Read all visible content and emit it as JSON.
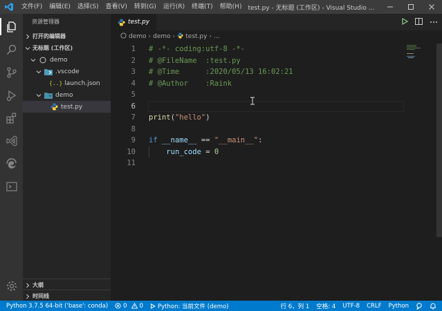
{
  "titlebar": {
    "menu": [
      "文件(F)",
      "编辑(E)",
      "选择(S)",
      "查看(V)",
      "转到(G)",
      "运行(R)",
      "终端(T)",
      "帮助(H)"
    ],
    "title": "test.py - 无标题 (工作区) - Visual Studio ..."
  },
  "activitybar": {
    "icons": [
      "files-icon",
      "search-icon",
      "source-control-icon",
      "run-debug-icon",
      "extensions-icon",
      "remote-icon",
      "edge-icon",
      "terminal-icon",
      "settings-gear-icon"
    ]
  },
  "sidebar": {
    "title": "资源管理器",
    "open_editors": "打开的编辑器",
    "workspace": "无标题 (工作区)",
    "tree": {
      "root": "demo",
      "vscode_folder": ".vscode",
      "launch_json": "launch.json",
      "demo_folder": "demo",
      "test_py": "test.py"
    },
    "outline": "大纲",
    "timeline": "时间线"
  },
  "editor": {
    "tab_label": "test.py",
    "breadcrumbs": [
      "demo",
      "demo",
      "test.py",
      "..."
    ],
    "line_numbers": [
      "1",
      "2",
      "3",
      "4",
      "5",
      "6",
      "7",
      "8",
      "9",
      "10",
      "11"
    ],
    "current_line": 6,
    "lines": [
      [
        {
          "t": "# -*- coding:utf-8 -*-",
          "c": "c"
        }
      ],
      [
        {
          "t": "# @FileName  :test.py",
          "c": "c"
        }
      ],
      [
        {
          "t": "# @Time      :2020/05/13 16:02:21",
          "c": "c"
        }
      ],
      [
        {
          "t": "# @Author    :Raink",
          "c": "c"
        }
      ],
      [],
      [],
      [
        {
          "t": "print",
          "c": "f"
        },
        {
          "t": "(",
          "c": "o"
        },
        {
          "t": "\"hello\"",
          "c": "s"
        },
        {
          "t": ")",
          "c": "o"
        }
      ],
      [],
      [
        {
          "t": "if",
          "c": "k"
        },
        {
          "t": " ",
          "c": "o"
        },
        {
          "t": "__name__",
          "c": "v"
        },
        {
          "t": " == ",
          "c": "o"
        },
        {
          "t": "\"__main__\"",
          "c": "s"
        },
        {
          "t": ":",
          "c": "o"
        }
      ],
      [
        {
          "t": "    ",
          "c": "o"
        },
        {
          "t": "run_code",
          "c": "v"
        },
        {
          "t": " = ",
          "c": "o"
        },
        {
          "t": "0",
          "c": "n"
        }
      ],
      []
    ]
  },
  "statusbar": {
    "interpreter": "Python 3.7.5 64-bit ('base': conda)",
    "errors": "0",
    "warnings": "0",
    "run_config": "Python: 当前文件 (demo)",
    "position": "行 6，列 1",
    "indent": "空格: 4",
    "encoding": "UTF-8",
    "eol": "CRLF",
    "language": "Python"
  },
  "colors": {
    "accent": "#007acc",
    "python_blue": "#3572a5",
    "python_yellow": "#ffd43b",
    "json_yellow": "#cbcb41",
    "folder_blue": "#519aba",
    "run_green": "#89d185"
  }
}
